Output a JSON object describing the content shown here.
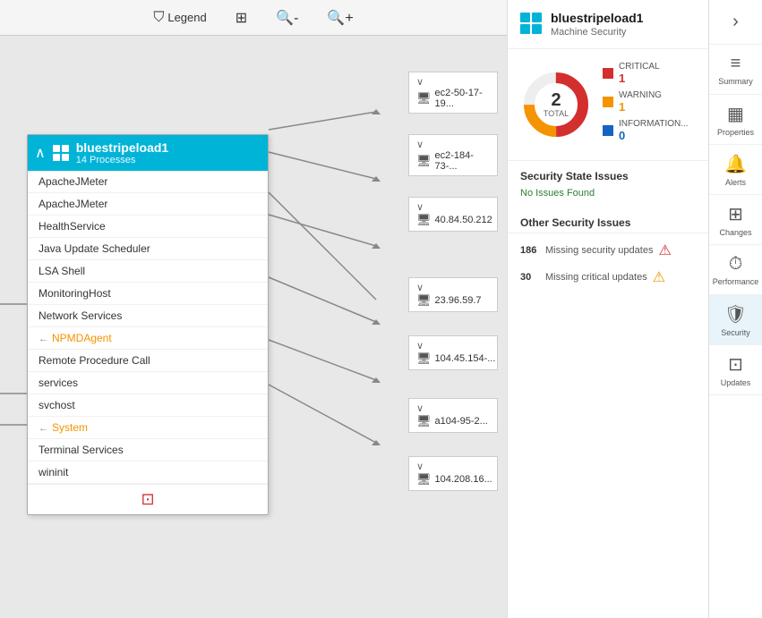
{
  "toolbar": {
    "legend_label": "Legend",
    "fit_label": "Fit",
    "zoom_in_label": "Zoom In",
    "zoom_out_label": "Zoom Out"
  },
  "node": {
    "title": "bluestripeload1",
    "subtitle": "14 Processes",
    "collapse_symbol": "∧",
    "processes": [
      {
        "name": "ApacheJMeter",
        "highlighted": false,
        "arrow_left": false
      },
      {
        "name": "ApacheJMeter",
        "highlighted": false,
        "arrow_left": false
      },
      {
        "name": "HealthService",
        "highlighted": false,
        "arrow_left": false
      },
      {
        "name": "Java Update Scheduler",
        "highlighted": false,
        "arrow_left": false
      },
      {
        "name": "LSA Shell",
        "highlighted": false,
        "arrow_left": false
      },
      {
        "name": "MonitoringHost",
        "highlighted": false,
        "arrow_left": false
      },
      {
        "name": "Network Services",
        "highlighted": false,
        "arrow_left": false
      },
      {
        "name": "NPMDAgent",
        "highlighted": true,
        "arrow_left": true
      },
      {
        "name": "Remote Procedure Call",
        "highlighted": false,
        "arrow_left": false
      },
      {
        "name": "services",
        "highlighted": false,
        "arrow_left": false
      },
      {
        "name": "svchost",
        "highlighted": false,
        "arrow_left": false
      },
      {
        "name": "System",
        "highlighted": true,
        "arrow_left": true
      },
      {
        "name": "Terminal Services",
        "highlighted": false,
        "arrow_left": false
      },
      {
        "name": "wininit",
        "highlighted": false,
        "arrow_left": false
      }
    ]
  },
  "machines": [
    {
      "name": "ec2-50-17-19...",
      "collapsed": true
    },
    {
      "name": "ec2-184-73-...",
      "collapsed": true
    },
    {
      "name": "40.84.50.212",
      "collapsed": true
    },
    {
      "name": "23.96.59.7",
      "collapsed": true
    },
    {
      "name": "104.45.154-...",
      "collapsed": true
    },
    {
      "name": "a104-95-2...",
      "collapsed": true
    },
    {
      "name": "104.208.16...",
      "collapsed": true
    }
  ],
  "detail_panel": {
    "title": "bluestripeload1",
    "subtitle": "Machine Security",
    "donut": {
      "total": 2,
      "total_label": "TOTAL",
      "segments": [
        {
          "label": "CRITICAL",
          "count": 1,
          "color": "#d32f2f"
        },
        {
          "label": "WARNING",
          "count": 1,
          "color": "#f59300"
        },
        {
          "label": "INFORMATION...",
          "count": 0,
          "color": "#1565c0"
        }
      ]
    },
    "security_state_title": "Security State Issues",
    "no_issues_text": "No Issues Found",
    "other_issues_title": "Other Security Issues",
    "issues": [
      {
        "count": 186,
        "text": "Missing security updates",
        "severity": "critical"
      },
      {
        "count": 30,
        "text": "Missing critical updates",
        "severity": "warning"
      }
    ]
  },
  "sidebar": {
    "chevron": "›",
    "items": [
      {
        "label": "Summary",
        "icon": "≡"
      },
      {
        "label": "Properties",
        "icon": "▦"
      },
      {
        "label": "Alerts",
        "icon": "🔔"
      },
      {
        "label": "Changes",
        "icon": "⊞"
      },
      {
        "label": "Performance",
        "icon": "⏱"
      },
      {
        "label": "Security",
        "icon": "🛡"
      },
      {
        "label": "Updates",
        "icon": "⊡"
      }
    ]
  }
}
